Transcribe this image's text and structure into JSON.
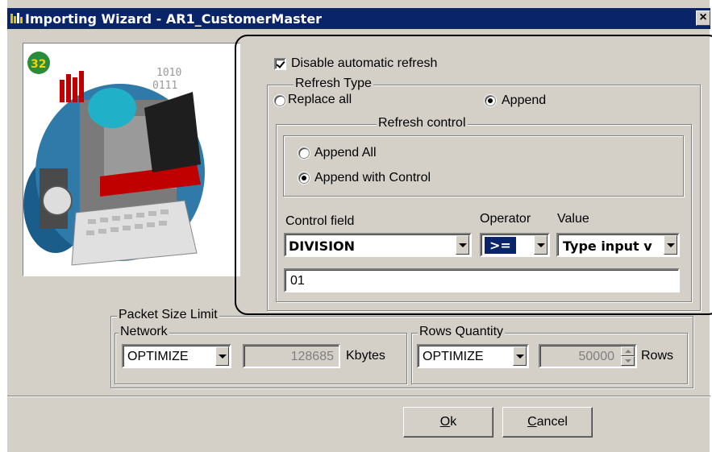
{
  "window": {
    "title": "Importing Wizard - AR1_CustomerMaster",
    "close_glyph": "×",
    "icon": "wizard-app-icon"
  },
  "artwork": {
    "icon": "computer-clipart-icon",
    "badge": "32"
  },
  "refresh": {
    "disable_label": "Disable automatic refresh",
    "disable_checked": true,
    "type_legend": "Refresh Type",
    "replace_all_label": "Replace all",
    "append_label": "Append",
    "selected_type": "Append",
    "control_legend": "Refresh control",
    "append_all_label": "Append All",
    "append_control_label": "Append with Control",
    "selected_control": "Append with Control",
    "control_field_label": "Control field",
    "operator_label": "Operator",
    "value_label": "Value",
    "control_field_value": "DIVISION",
    "operator_value": ">=",
    "value_type_value": "Type input v",
    "value_input": "01"
  },
  "packet": {
    "legend": "Packet Size Limit",
    "network_legend": "Network",
    "network_mode": "OPTIMIZE",
    "network_value": "128685",
    "network_unit": "Kbytes",
    "rows_legend": "Rows Quantity",
    "rows_mode": "OPTIMIZE",
    "rows_value": "50000",
    "rows_unit": "Rows"
  },
  "buttons": {
    "ok_label": "k",
    "ok_mnemonic": "O",
    "cancel_label": "ancel",
    "cancel_mnemonic": "C"
  },
  "colors": {
    "titlebar": "#0a246a",
    "face": "#d4d0c8",
    "selection": "#0a246a"
  }
}
